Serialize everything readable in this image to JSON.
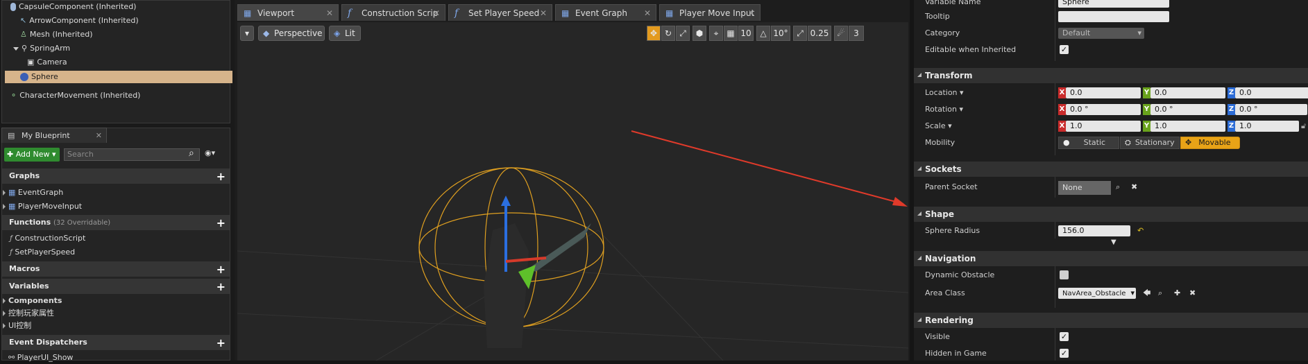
{
  "components": {
    "items": [
      "CapsuleComponent (Inherited)",
      "ArrowComponent (Inherited)",
      "Mesh (Inherited)",
      "SpringArm",
      "Camera",
      "Sphere",
      "CharacterMovement (Inherited)"
    ]
  },
  "blueprint": {
    "tab_label": "My Blueprint",
    "add_new": "Add New",
    "search_placeholder": "Search",
    "sections": {
      "graphs": "Graphs",
      "functions": "Functions",
      "functions_hint": "(32 Overridable)",
      "macros": "Macros",
      "variables": "Variables",
      "event_dispatchers": "Event Dispatchers"
    },
    "graphs": [
      "EventGraph",
      "PlayerMoveInput"
    ],
    "functions": [
      "ConstructionScript",
      "SetPlayerSpeed"
    ],
    "variables": [
      "Components",
      "控制玩家属性",
      "UI控制"
    ],
    "dispatchers": [
      "PlayerUI_Show"
    ]
  },
  "tabs": [
    "Viewport",
    "Construction Scrip",
    "Set Player Speed",
    "Event Graph",
    "Player Move Input"
  ],
  "viewport": {
    "perspective": "Perspective",
    "lit": "Lit",
    "grid": "10",
    "angle": "10°",
    "scale": "0.25",
    "speed": "3"
  },
  "details": {
    "variable_name_label": "Variable Name",
    "variable_name": "Sphere",
    "tooltip_label": "Tooltip",
    "tooltip": "",
    "category_label": "Category",
    "category": "Default",
    "editable_label": "Editable when Inherited",
    "transform": {
      "title": "Transform",
      "location": "Location",
      "rotation": "Rotation",
      "scale": "Scale",
      "mobility": "Mobility",
      "loc": [
        "0.0",
        "0.0",
        "0.0"
      ],
      "rot": [
        "0.0 °",
        "0.0 °",
        "0.0 °"
      ],
      "scl": [
        "1.0",
        "1.0",
        "1.0"
      ],
      "static": "Static",
      "stationary": "Stationary",
      "movable": "Movable"
    },
    "sockets": {
      "title": "Sockets",
      "parent_socket": "Parent Socket",
      "value": "None"
    },
    "shape": {
      "title": "Shape",
      "sphere_radius": "Sphere Radius",
      "value": "156.0"
    },
    "navigation": {
      "title": "Navigation",
      "dynamic_obstacle": "Dynamic Obstacle",
      "area_class": "Area Class",
      "area_value": "NavArea_Obstacle"
    },
    "rendering": {
      "title": "Rendering",
      "visible": "Visible",
      "hidden": "Hidden in Game"
    }
  },
  "colors": {
    "selected_row": "#d6b48b",
    "movable": "#e8a317",
    "axis_x": "#c92b2b",
    "axis_y": "#6aa31d",
    "axis_z": "#2c6cd6"
  }
}
